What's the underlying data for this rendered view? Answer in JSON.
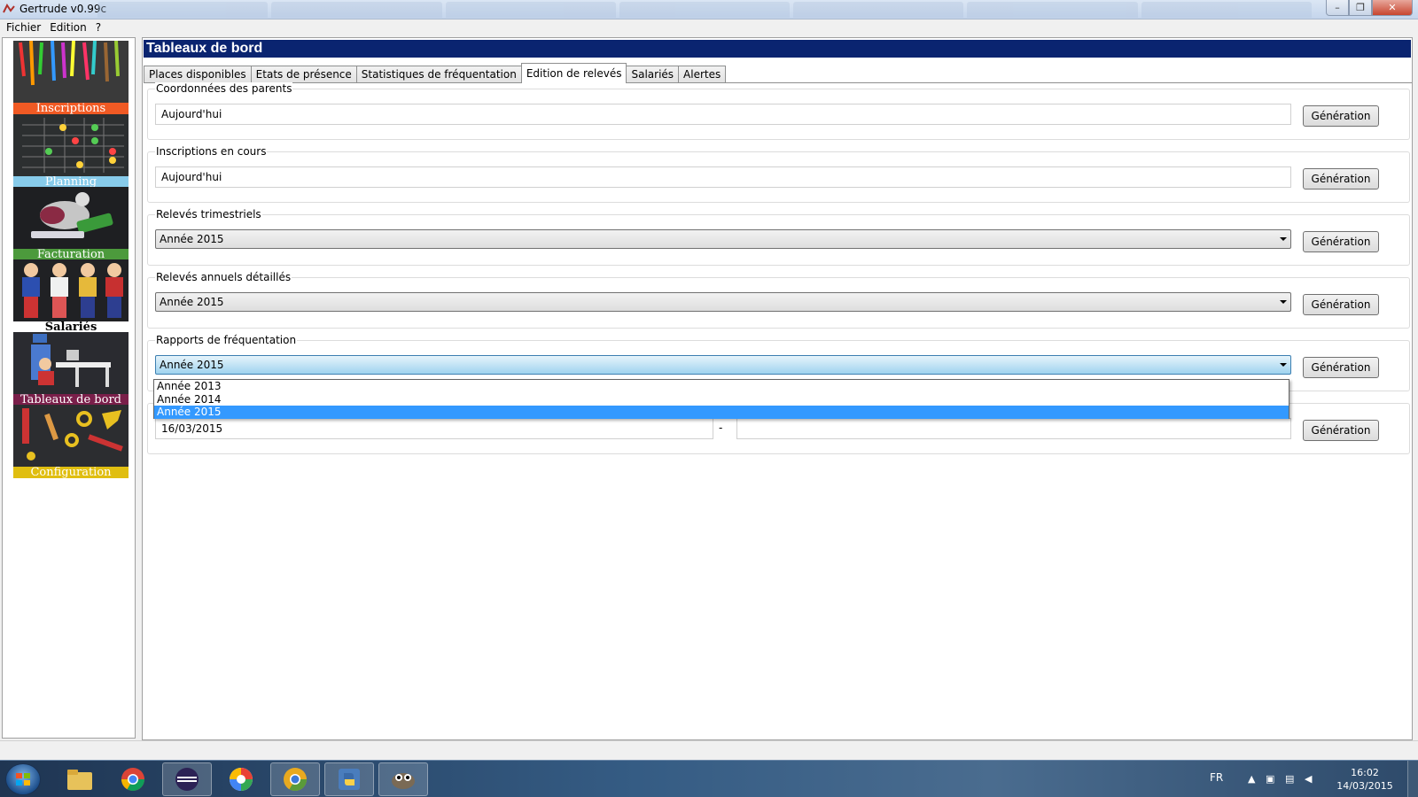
{
  "window": {
    "title": "Gertrude v0.99c"
  },
  "menu": {
    "items": [
      "Fichier",
      "Edition",
      "?"
    ]
  },
  "sidebar": {
    "items": [
      {
        "label": "Inscriptions",
        "color": "#f05a24"
      },
      {
        "label": "Planning",
        "color": "#87cbea"
      },
      {
        "label": "Facturation",
        "color": "#4c9a3c"
      },
      {
        "label": "Salariés",
        "color": "#ffffff"
      },
      {
        "label": "Tableaux de bord",
        "color": "#7a1f4a"
      },
      {
        "label": "Configuration",
        "color": "#e0be10"
      }
    ]
  },
  "header": {
    "title": "Tableaux de bord"
  },
  "tabs": [
    {
      "label": "Places disponibles"
    },
    {
      "label": "Etats de présence"
    },
    {
      "label": "Statistiques de fréquentation"
    },
    {
      "label": "Edition de relevés"
    },
    {
      "label": "Salariés"
    },
    {
      "label": "Alertes"
    }
  ],
  "active_tab": "Edition de relevés",
  "sections": {
    "parents": {
      "title": "Coordonnées des parents",
      "value": "Aujourd'hui",
      "button": "Génération"
    },
    "inscriptions": {
      "title": "Inscriptions en cours",
      "value": "Aujourd'hui",
      "button": "Génération"
    },
    "trimestriels": {
      "title": "Relevés trimestriels",
      "value": "Année 2015",
      "button": "Génération"
    },
    "annuels": {
      "title": "Relevés annuels détaillés",
      "value": "Année 2015",
      "button": "Génération"
    },
    "rapports": {
      "title": "Rapports de fréquentation",
      "value": "Année 2015",
      "button": "Génération"
    },
    "dates": {
      "from": "16/03/2015",
      "separator": "-",
      "to": "",
      "button": "Génération"
    }
  },
  "dropdown": {
    "options": [
      "Année 2013",
      "Année 2014",
      "Année 2015"
    ],
    "selected": "Année 2015"
  },
  "taskbar": {
    "apps": [
      "folder-icon",
      "chrome-icon",
      "eclipse-icon",
      "picasa-icon",
      "chrome-canary-icon",
      "python-icon",
      "gimp-icon"
    ],
    "language": "FR",
    "time": "16:02",
    "date": "14/03/2015"
  },
  "colors": {
    "header": "#0a2470",
    "selection": "#3399ff"
  }
}
